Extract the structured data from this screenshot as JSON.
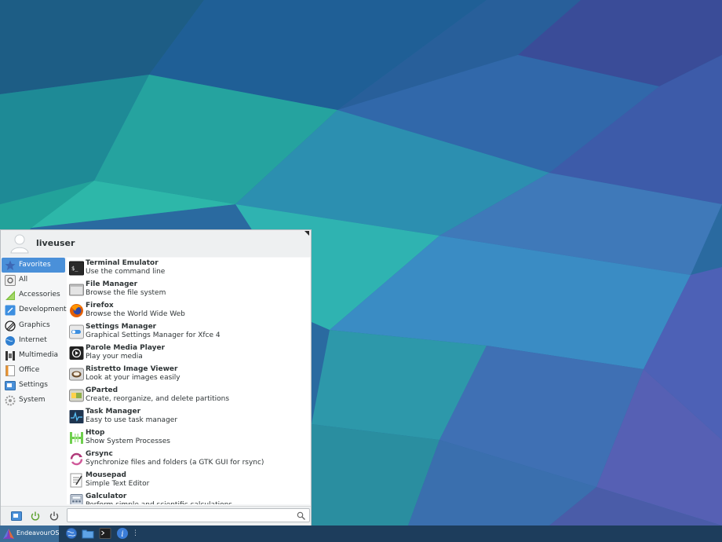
{
  "colors": {
    "accent": "#4a90d9",
    "panel": "#1d3d5c",
    "start_button": "#3b6d99"
  },
  "user": {
    "name": "liveuser"
  },
  "categories": [
    {
      "label": "Favorites",
      "icon": "star-icon",
      "active": true
    },
    {
      "label": "All",
      "icon": "all-apps-icon"
    },
    {
      "label": "Accessories",
      "icon": "accessories-icon"
    },
    {
      "label": "Development",
      "icon": "development-icon"
    },
    {
      "label": "Graphics",
      "icon": "graphics-icon"
    },
    {
      "label": "Internet",
      "icon": "internet-icon"
    },
    {
      "label": "Multimedia",
      "icon": "multimedia-icon"
    },
    {
      "label": "Office",
      "icon": "office-icon"
    },
    {
      "label": "Settings",
      "icon": "settings-icon"
    },
    {
      "label": "System",
      "icon": "system-icon"
    }
  ],
  "apps": [
    {
      "name": "Terminal Emulator",
      "desc": "Use the command line",
      "icon": "terminal-icon"
    },
    {
      "name": "File Manager",
      "desc": "Browse the file system",
      "icon": "file-manager-icon"
    },
    {
      "name": "Firefox",
      "desc": "Browse the World Wide Web",
      "icon": "firefox-icon"
    },
    {
      "name": "Settings Manager",
      "desc": "Graphical Settings Manager for Xfce 4",
      "icon": "settings-manager-icon"
    },
    {
      "name": "Parole Media Player",
      "desc": "Play your media",
      "icon": "media-player-icon"
    },
    {
      "name": "Ristretto Image Viewer",
      "desc": "Look at your images easily",
      "icon": "image-viewer-icon"
    },
    {
      "name": "GParted",
      "desc": "Create, reorganize, and delete partitions",
      "icon": "gparted-icon"
    },
    {
      "name": "Task Manager",
      "desc": "Easy to use task manager",
      "icon": "task-manager-icon"
    },
    {
      "name": "Htop",
      "desc": "Show System Processes",
      "icon": "htop-icon"
    },
    {
      "name": "Grsync",
      "desc": "Synchronize files and folders (a GTK GUI for rsync)",
      "icon": "grsync-icon"
    },
    {
      "name": "Mousepad",
      "desc": "Simple Text Editor",
      "icon": "text-editor-icon"
    },
    {
      "name": "Galculator",
      "desc": "Perform simple and scientific calculations",
      "icon": "calculator-icon"
    }
  ],
  "footer": {
    "settings_icon": "settings-button-icon",
    "lock_icon": "lock-screen-icon",
    "power_icon": "power-icon"
  },
  "search": {
    "value": "",
    "placeholder": ""
  },
  "panel": {
    "start_label": "EndeavourOS",
    "launchers": [
      "web-browser-icon",
      "files-icon",
      "terminal-icon",
      "info-icon"
    ],
    "separator": "⋮"
  }
}
